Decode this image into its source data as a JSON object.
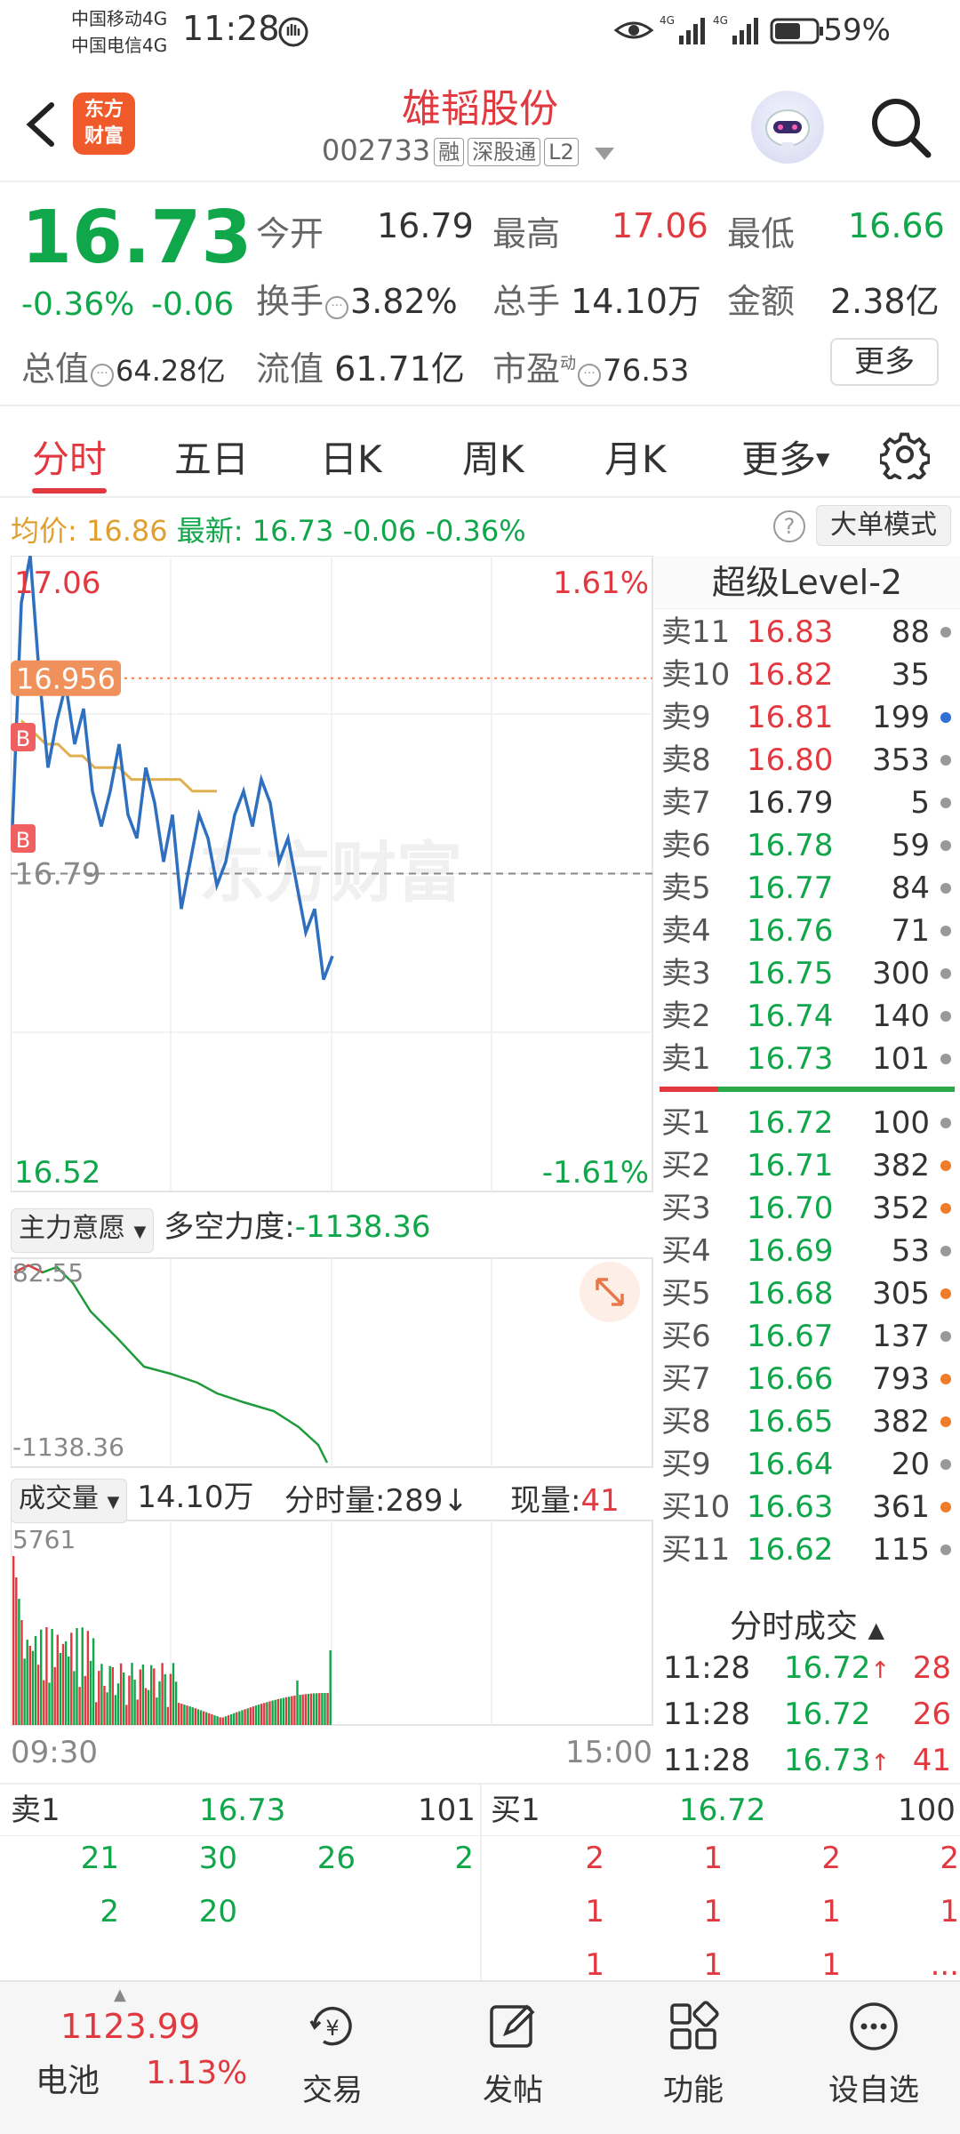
{
  "status_bar": {
    "carrier1": "中国移动4G",
    "carrier2": "中国电信4G",
    "time": "11:28",
    "battery": "59%"
  },
  "header": {
    "logo_line1": "东方",
    "logo_line2": "财富",
    "stock_name": "雄韬股份",
    "stock_code": "002733",
    "tags": [
      "融",
      "深股通",
      "L2"
    ]
  },
  "quote": {
    "price": "16.73",
    "change_pct": "-0.36%",
    "change": "-0.06",
    "open_label": "今开",
    "open": "16.79",
    "high_label": "最高",
    "high": "17.06",
    "low_label": "最低",
    "low": "16.66",
    "turnover_label": "换手",
    "turnover": "3.82%",
    "volume_label": "总手",
    "volume": "14.10万",
    "amount_label": "金额",
    "amount": "2.38亿",
    "mktcap_label": "总值",
    "mktcap": "64.28亿",
    "float_label": "流值",
    "float_cap": "61.71亿",
    "pe_label": "市盈",
    "pe_sup": "动",
    "pe": "76.53",
    "more_button": "更多"
  },
  "tabs": [
    "分时",
    "五日",
    "日K",
    "周K",
    "月K",
    "更多"
  ],
  "avg_row": {
    "avg_label": "均价:",
    "avg": "16.86",
    "latest_label": "最新:",
    "latest": "16.73",
    "change": "-0.06",
    "change_pct": "-0.36%",
    "big_order_mode": "大单模式"
  },
  "chart": {
    "y_max": "17.06",
    "y_max_pct": "1.61%",
    "y_min": "16.52",
    "y_min_pct": "-1.61%",
    "pre_close": "16.79",
    "marker_price": "16.956",
    "buy_marker": "B",
    "watermark": "东方财富",
    "time_start": "09:30",
    "time_end": "15:00",
    "main_force_label": "主力意愿",
    "power_label": "多空力度:",
    "power_value": "-1138.36",
    "power_top": "82.55",
    "power_bottom": "-1138.36",
    "volume_label": "成交量",
    "volume_total": "14.10万",
    "minute_volume_label": "分时量:",
    "minute_volume": "289",
    "current_volume_label": "现量:",
    "current_volume": "41",
    "vol_max": "5761"
  },
  "chart_data": {
    "type": "line",
    "series": [
      {
        "values": [
          16.83,
          17.02,
          17.06,
          16.96,
          16.88,
          16.92,
          16.95,
          16.9,
          16.93,
          16.86,
          16.83,
          16.86,
          16.9,
          16.84,
          16.82,
          16.88,
          16.85,
          16.8,
          16.84,
          16.76,
          16.8,
          16.84,
          16.82,
          16.78,
          16.8,
          16.84,
          16.86,
          16.83,
          16.87,
          16.85,
          16.8,
          16.82,
          16.78,
          16.74,
          16.76,
          16.7,
          16.72
        ]
      },
      {
        "values": [
          16.92,
          16.91,
          16.9,
          16.9,
          16.89,
          16.89,
          16.88,
          16.88,
          16.88,
          16.87,
          16.87,
          16.87,
          16.87,
          16.87,
          16.86,
          16.86,
          16.86
        ]
      }
    ],
    "ylim": [
      16.52,
      17.06
    ]
  },
  "order_book": {
    "title": "超级Level-2",
    "asks": [
      {
        "label": "卖11",
        "price": "16.83",
        "vol": "88",
        "dot": "#999999"
      },
      {
        "label": "卖10",
        "price": "16.82",
        "vol": "35",
        "dot": ""
      },
      {
        "label": "卖9",
        "price": "16.81",
        "vol": "199",
        "dot": "#2f6fd6"
      },
      {
        "label": "卖8",
        "price": "16.80",
        "vol": "353",
        "dot": "#999999"
      },
      {
        "label": "卖7",
        "price": "16.79",
        "vol": "5",
        "dot": "#999999"
      },
      {
        "label": "卖6",
        "price": "16.78",
        "vol": "59",
        "dot": "#999999"
      },
      {
        "label": "卖5",
        "price": "16.77",
        "vol": "84",
        "dot": "#999999"
      },
      {
        "label": "卖4",
        "price": "16.76",
        "vol": "71",
        "dot": "#999999"
      },
      {
        "label": "卖3",
        "price": "16.75",
        "vol": "300",
        "dot": "#999999"
      },
      {
        "label": "卖2",
        "price": "16.74",
        "vol": "140",
        "dot": "#999999"
      },
      {
        "label": "卖1",
        "price": "16.73",
        "vol": "101",
        "dot": "#999999"
      }
    ],
    "bids": [
      {
        "label": "买1",
        "price": "16.72",
        "vol": "100",
        "dot": "#999999"
      },
      {
        "label": "买2",
        "price": "16.71",
        "vol": "382",
        "dot": "#f07b2a"
      },
      {
        "label": "买3",
        "price": "16.70",
        "vol": "352",
        "dot": "#f07b2a"
      },
      {
        "label": "买4",
        "price": "16.69",
        "vol": "53",
        "dot": "#999999"
      },
      {
        "label": "买5",
        "price": "16.68",
        "vol": "305",
        "dot": "#f07b2a"
      },
      {
        "label": "买6",
        "price": "16.67",
        "vol": "137",
        "dot": "#999999"
      },
      {
        "label": "买7",
        "price": "16.66",
        "vol": "793",
        "dot": "#f07b2a"
      },
      {
        "label": "买8",
        "price": "16.65",
        "vol": "382",
        "dot": "#f07b2a"
      },
      {
        "label": "买9",
        "price": "16.64",
        "vol": "20",
        "dot": "#999999"
      },
      {
        "label": "买10",
        "price": "16.63",
        "vol": "361",
        "dot": "#f07b2a"
      },
      {
        "label": "买11",
        "price": "16.62",
        "vol": "115",
        "dot": "#999999"
      }
    ]
  },
  "ticks": {
    "title": "分时成交",
    "rows": [
      {
        "time": "11:28",
        "price": "16.72",
        "arrow": "↑",
        "vol": "28"
      },
      {
        "time": "11:28",
        "price": "16.72",
        "arrow": "",
        "vol": "26"
      },
      {
        "time": "11:28",
        "price": "16.73",
        "arrow": "↑",
        "vol": "41"
      }
    ]
  },
  "level_bottom": {
    "ask_label": "卖1",
    "ask_price": "16.73",
    "ask_vol": "101",
    "bid_label": "买1",
    "bid_price": "16.72",
    "bid_vol": "100",
    "ask_queue": [
      [
        "21",
        "30",
        "26",
        "2"
      ],
      [
        "2",
        "20",
        "",
        ""
      ]
    ],
    "bid_queue": [
      [
        "2",
        "1",
        "2",
        "2"
      ],
      [
        "1",
        "1",
        "1",
        "1"
      ],
      [
        "1",
        "1",
        "1",
        "..."
      ]
    ]
  },
  "bottom_nav": {
    "index_value": "1123.99",
    "index_name": "电池",
    "index_pct": "1.13%",
    "items": [
      "交易",
      "发帖",
      "功能",
      "设自选"
    ]
  },
  "colors": {
    "up": "#e2383f",
    "down": "#10a64a",
    "price_line": "#2f6fbf",
    "avg_line": "#e0b050",
    "accent": "#f0592a"
  }
}
